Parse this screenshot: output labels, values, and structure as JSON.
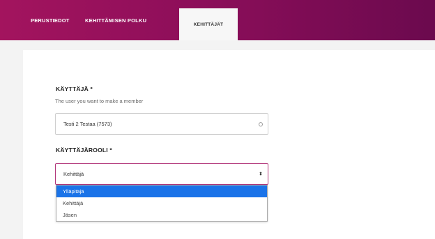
{
  "tabs": [
    {
      "label": "PERUSTIEDOT",
      "active": false
    },
    {
      "label": "KEHITTÄMISEN POLKU",
      "active": false
    },
    {
      "label": "KEHITTÄJÄT",
      "active": true
    }
  ],
  "form": {
    "user": {
      "label": "KÄYTTÄJÄ *",
      "help": "The user you want to make a member",
      "value": "Testi 2 Testaa (7573)"
    },
    "role": {
      "label": "KÄYTTÄJÄROOLI *",
      "value": "Kehittäjä",
      "options": [
        "Ylläpitäjä",
        "Kehittäjä",
        "Jäsen"
      ],
      "highlighted_option": "Ylläpitäjä"
    }
  },
  "colors": {
    "header_start": "#a3145e",
    "header_end": "#6b0a4e",
    "option_highlight": "#1a73e8",
    "focus_border": "#b2367a"
  },
  "icons": {
    "user_field": "circle-icon",
    "role_field": "updown-arrows-icon"
  }
}
